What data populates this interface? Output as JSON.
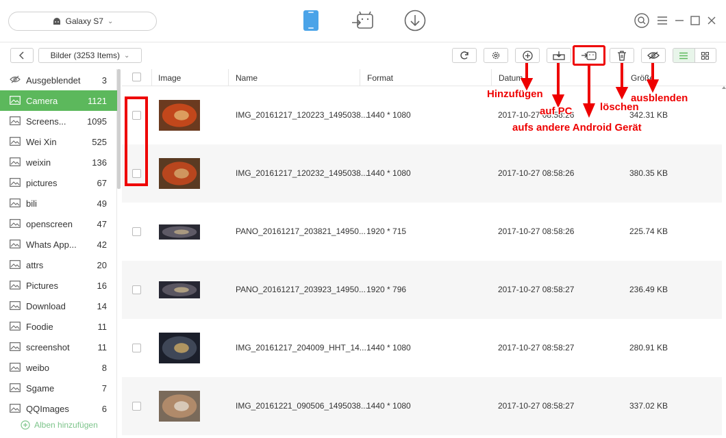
{
  "device": {
    "name": "Galaxy S7"
  },
  "toolbar": {
    "back": "<",
    "folder_label": "Bilder (3253 Items)"
  },
  "columns": {
    "image": "Image",
    "name": "Name",
    "format": "Format",
    "date": "Datum",
    "size": "Größe"
  },
  "sidebar": {
    "items": [
      {
        "label": "Ausgeblendet",
        "count": "3"
      },
      {
        "label": "Camera",
        "count": "1121"
      },
      {
        "label": "Screens...",
        "count": "1095"
      },
      {
        "label": "Wei Xin",
        "count": "525"
      },
      {
        "label": "weixin",
        "count": "136"
      },
      {
        "label": "pictures",
        "count": "67"
      },
      {
        "label": "bili",
        "count": "49"
      },
      {
        "label": "openscreen",
        "count": "47"
      },
      {
        "label": "Whats App...",
        "count": "42"
      },
      {
        "label": "attrs",
        "count": "20"
      },
      {
        "label": "Pictures",
        "count": "16"
      },
      {
        "label": "Download",
        "count": "14"
      },
      {
        "label": "Foodie",
        "count": "11"
      },
      {
        "label": "screenshot",
        "count": "11"
      },
      {
        "label": "weibo",
        "count": "8"
      },
      {
        "label": "Sgame",
        "count": "7"
      },
      {
        "label": "QQImages",
        "count": "6"
      }
    ],
    "add_album": "Alben hinzufügen"
  },
  "rows": [
    {
      "name": "IMG_20161217_120223_1495038...",
      "format": "1440 * 1080",
      "date": "2017-10-27 08:58:26",
      "size": "342.31 KB"
    },
    {
      "name": "IMG_20161217_120232_1495038...",
      "format": "1440 * 1080",
      "date": "2017-10-27 08:58:26",
      "size": "380.35 KB"
    },
    {
      "name": "PANO_20161217_203821_14950...",
      "format": "1920 * 715",
      "date": "2017-10-27 08:58:26",
      "size": "225.74 KB"
    },
    {
      "name": "PANO_20161217_203923_14950...",
      "format": "1920 * 796",
      "date": "2017-10-27 08:58:27",
      "size": "236.49 KB"
    },
    {
      "name": "IMG_20161217_204009_HHT_14...",
      "format": "1440 * 1080",
      "date": "2017-10-27 08:58:27",
      "size": "280.91 KB"
    },
    {
      "name": "IMG_20161221_090506_1495038...",
      "format": "1440 * 1080",
      "date": "2017-10-27 08:58:27",
      "size": "337.02 KB"
    }
  ],
  "annotations": {
    "add": "Hinzufügen",
    "to_pc": "auf PC",
    "to_android": "aufs andere Android Gerät",
    "delete": "löschen",
    "hide": "ausblenden"
  },
  "colors": {
    "accent": "#5cb85c",
    "annotation": "#ee0000",
    "phone_icon": "#4aa3e8"
  }
}
